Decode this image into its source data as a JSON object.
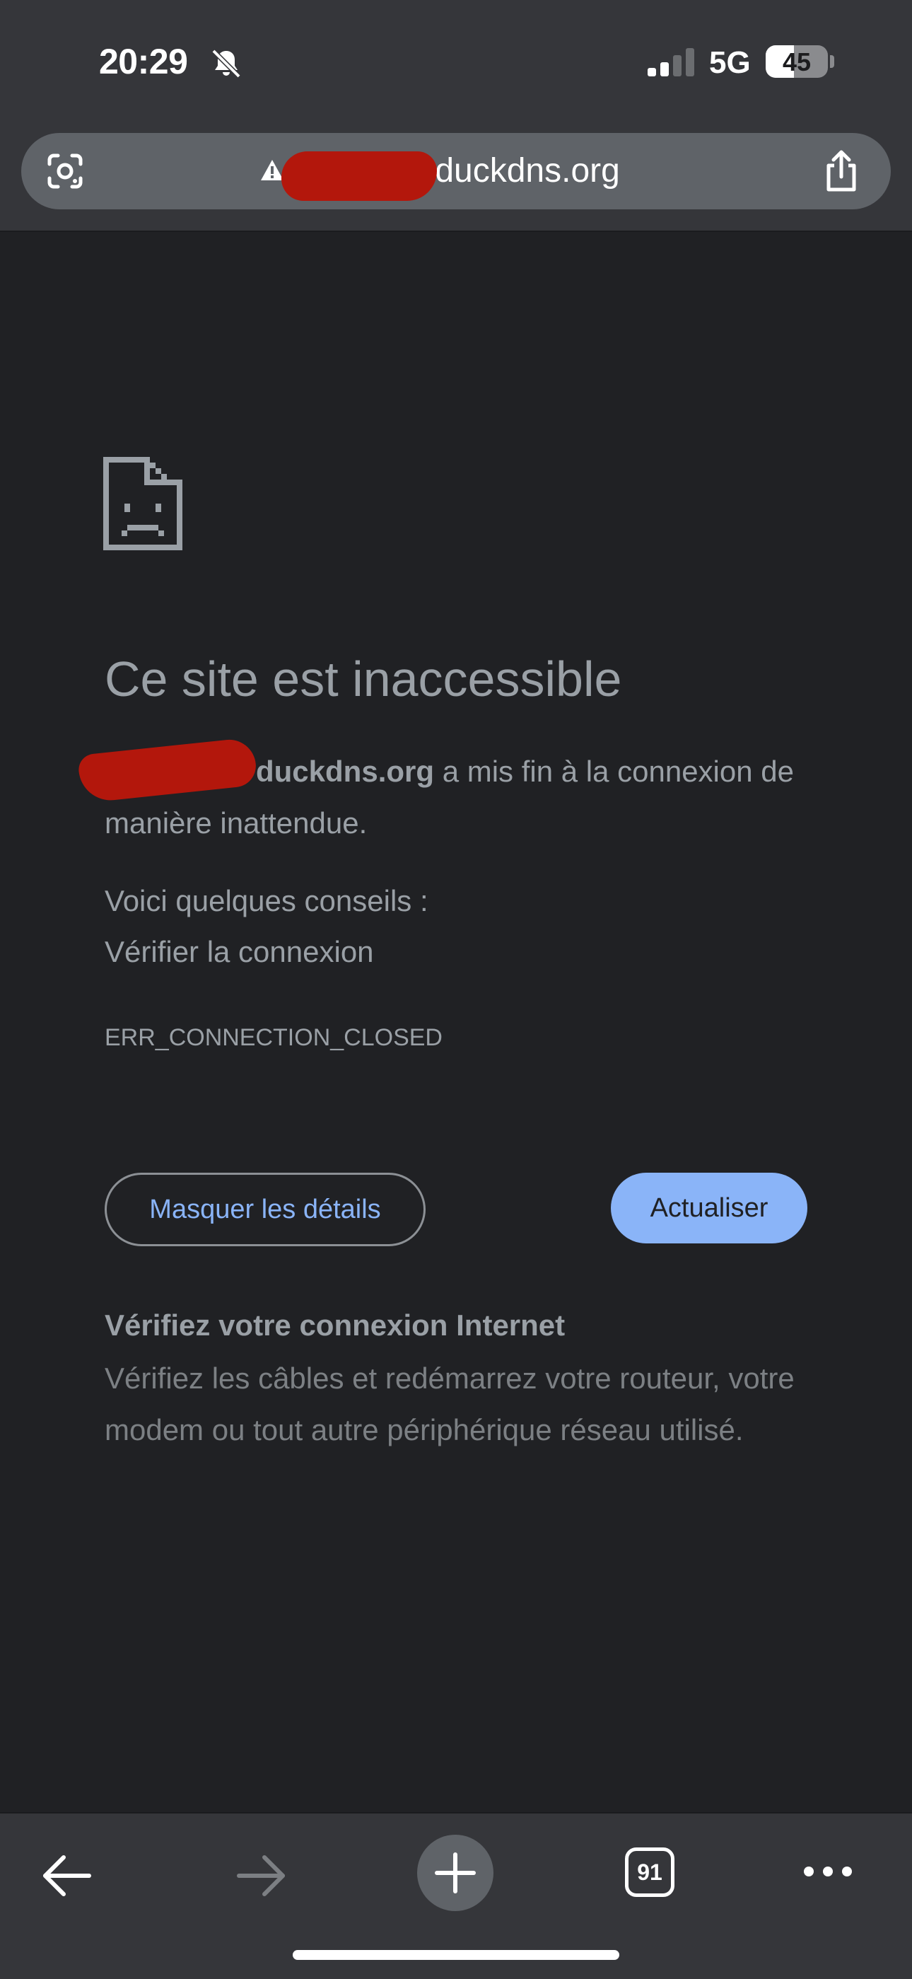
{
  "status_bar": {
    "time": "20:29",
    "network": "5G",
    "battery": "45",
    "battery_level_percent": 45,
    "signal_bars": 2,
    "icons": [
      "bell-slash-icon",
      "signal-icon",
      "battery-icon"
    ]
  },
  "address_bar": {
    "url": ".duckdns.org",
    "url_hidden_part": "xxxxxxx",
    "icons": [
      "lens-icon",
      "warning-icon",
      "share-icon"
    ]
  },
  "error_page": {
    "icon": "sad-file-icon",
    "title": "Ce site est inaccessible",
    "host_bold": "duckdns.org",
    "message_rest": " a mis fin à la connexion de manière inattendue.",
    "tips_intro": "Voici quelques conseils :",
    "tips": [
      "Vérifier la connexion"
    ],
    "error_code": "ERR_CONNECTION_CLOSED",
    "details_button": "Masquer les détails",
    "reload_button": "Actualiser",
    "help_heading": "Vérifiez votre connexion Internet",
    "help_body": "Vérifiez les câbles et redémarrez votre routeur, votre modem ou tout autre périphérique réseau utilisé."
  },
  "toolbar": {
    "tab_count": "91",
    "icons": [
      "back-icon",
      "forward-icon",
      "plus-icon",
      "tabs-icon",
      "more-icon"
    ]
  },
  "colors": {
    "background": "#202124",
    "chrome": "#35363a",
    "accent": "#8ab4f8",
    "text": "#9aa0a6",
    "redaction": "#b3170c"
  }
}
